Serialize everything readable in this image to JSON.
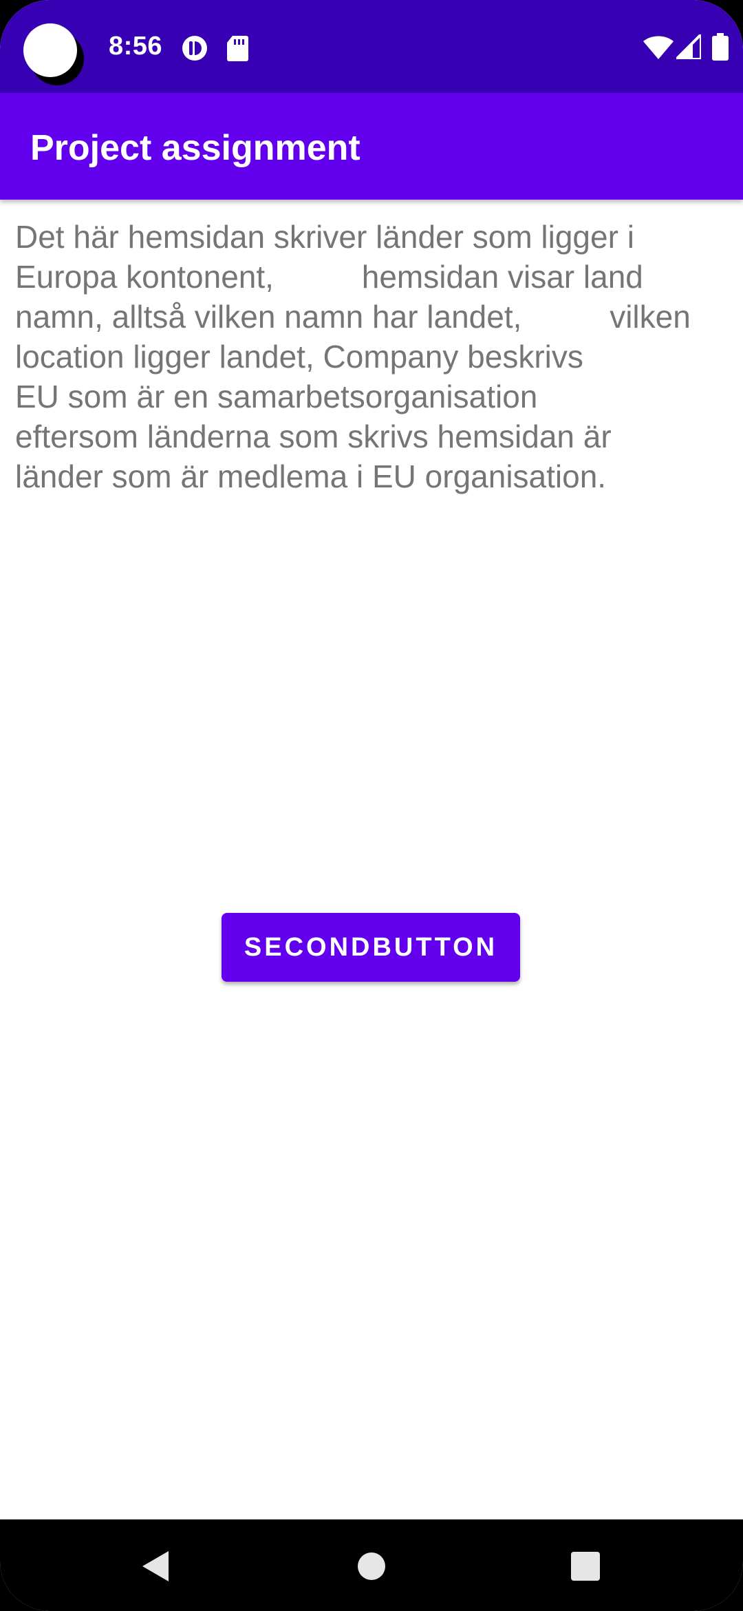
{
  "status_bar": {
    "time": "8:56",
    "icons": [
      "camera-cutout",
      "data-saver-icon",
      "sd-card-icon",
      "wifi-icon",
      "signal-icon",
      "battery-icon"
    ]
  },
  "app_bar": {
    "title": "Project assignment"
  },
  "content": {
    "description": "Det här hemsidan skriver länder som ligger i\nEuropa kontonent,          hemsidan visar land\nnamn, alltså vilken namn har landet,          vilken\nlocation ligger landet, Company beskrivs\nEU som är en samarbetsorganisation\neftersom länderna som skrivs hemsidan är\nländer som är medlema i EU organisation.",
    "button_label": "SECONDBUTTON"
  },
  "nav_bar": {
    "icons": [
      "back-icon",
      "home-icon",
      "recents-icon"
    ]
  },
  "colors": {
    "status_bar": "#3700B3",
    "primary": "#6200EE",
    "text_secondary": "#757575"
  }
}
